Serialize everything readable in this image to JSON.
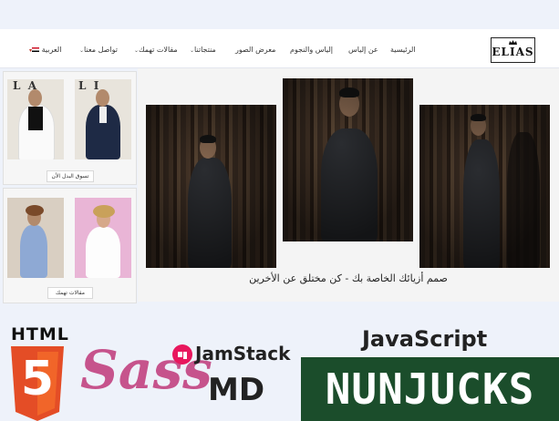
{
  "header": {
    "logo_text": "ELIAS",
    "nav": [
      {
        "label": "الرئيسية",
        "has_dropdown": false
      },
      {
        "label": "عن إلياس",
        "has_dropdown": false
      },
      {
        "label": "إلياس والنجوم",
        "has_dropdown": false
      },
      {
        "label": "معرض الصور",
        "has_dropdown": false
      },
      {
        "label": "منتجاتنا",
        "has_dropdown": true
      },
      {
        "label": "مقالات تهمك",
        "has_dropdown": false
      },
      {
        "label": "تواصل معنا",
        "has_dropdown": true
      },
      {
        "label": "العربية",
        "has_dropdown": true
      }
    ]
  },
  "hero": {
    "caption": "صمم أزيائك الخاصة بك - كن مختلق عن الأخرين"
  },
  "sidebar": {
    "cards": [
      {
        "button_label": "تسوق البدل الأن"
      },
      {
        "button_label": "مقالات تهمك"
      }
    ]
  },
  "tech_logos": {
    "html": "HTML",
    "html_shield": "5",
    "sass": "Sass",
    "jamstack": "JamStack",
    "md": "MD",
    "javascript": "JavaScript",
    "nunjucks": "NUNJUCKS"
  },
  "colors": {
    "page_bg": "#eef2fa",
    "html5_orange": "#e44d26",
    "sass_pink": "#c6538c",
    "nunjucks_green": "#1b4d2b",
    "jamstack_red": "#e8175d"
  }
}
